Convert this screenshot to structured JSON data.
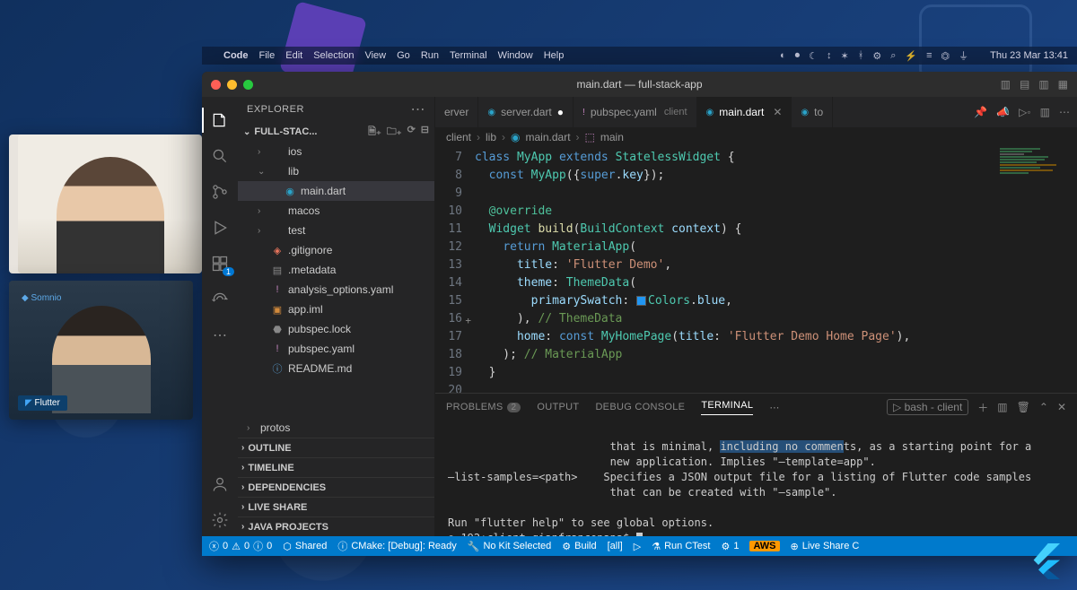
{
  "macbar": {
    "apple": "",
    "items": [
      "Code",
      "File",
      "Edit",
      "Selection",
      "View",
      "Go",
      "Run",
      "Terminal",
      "Window",
      "Help"
    ],
    "right_icons": [
      "◐",
      "⏺",
      "☾",
      "↕",
      "✶",
      "ᚼ",
      "⚙",
      "⌕",
      "⚡",
      "≡",
      "⏣",
      "⏚"
    ],
    "datetime": "Thu 23 Mar  13:41"
  },
  "window": {
    "title": "main.dart — full-stack-app"
  },
  "explorer": {
    "header": "EXPLORER",
    "project": "FULL-STAC...",
    "tree": [
      {
        "label": "ios",
        "chev": "›",
        "depth": 1,
        "icon": ""
      },
      {
        "label": "lib",
        "chev": "⌄",
        "depth": 1,
        "icon": ""
      },
      {
        "label": "main.dart",
        "chev": "",
        "depth": 2,
        "icon": "◉",
        "color": "#2aa3c9",
        "sel": true
      },
      {
        "label": "macos",
        "chev": "›",
        "depth": 1,
        "icon": ""
      },
      {
        "label": "test",
        "chev": "›",
        "depth": 1,
        "icon": ""
      },
      {
        "label": ".gitignore",
        "chev": "",
        "depth": 1,
        "icon": "◈",
        "color": "#e8745c"
      },
      {
        "label": ".metadata",
        "chev": "",
        "depth": 1,
        "icon": "▤",
        "color": "#888"
      },
      {
        "label": "analysis_options.yaml",
        "chev": "",
        "depth": 1,
        "icon": "!",
        "color": "#c586c0"
      },
      {
        "label": "app.iml",
        "chev": "",
        "depth": 1,
        "icon": "▣",
        "color": "#d28a3c"
      },
      {
        "label": "pubspec.lock",
        "chev": "",
        "depth": 1,
        "icon": "⬣",
        "color": "#888"
      },
      {
        "label": "pubspec.yaml",
        "chev": "",
        "depth": 1,
        "icon": "!",
        "color": "#c586c0"
      },
      {
        "label": "README.md",
        "chev": "",
        "depth": 1,
        "icon": "ⓘ",
        "color": "#5a9fd4"
      }
    ],
    "bottom_tree": [
      {
        "label": "protos",
        "chev": "›",
        "depth": 0
      }
    ],
    "sections": [
      "OUTLINE",
      "TIMELINE",
      "DEPENDENCIES",
      "LIVE SHARE",
      "JAVA PROJECTS"
    ]
  },
  "tabs": [
    {
      "label": "server",
      "icon": "",
      "sub": "erver",
      "active": false,
      "mod": false,
      "partial": true
    },
    {
      "label": "server.dart",
      "icon": "◉",
      "iconColor": "#2aa3c9",
      "active": false,
      "mod": true
    },
    {
      "label": "pubspec.yaml",
      "icon": "!",
      "iconColor": "#c586c0",
      "sub": "client",
      "active": false,
      "mod": false
    },
    {
      "label": "main.dart",
      "icon": "◉",
      "iconColor": "#2aa3c9",
      "active": true,
      "mod": false
    },
    {
      "label": "to",
      "icon": "◉",
      "iconColor": "#2aa3c9",
      "active": false,
      "partial": true
    }
  ],
  "breadcrumb": [
    "client",
    "lib",
    "main.dart",
    "main"
  ],
  "code": {
    "start": 7,
    "lines": [
      [
        [
          "kw",
          "class "
        ],
        [
          "ty",
          "MyApp "
        ],
        [
          "kw",
          "extends "
        ],
        [
          "ty",
          "StatelessWidget "
        ],
        [
          "pn",
          "{"
        ]
      ],
      [
        [
          "pn",
          "  "
        ],
        [
          "kw",
          "const "
        ],
        [
          "ty",
          "MyApp"
        ],
        [
          "pn",
          "({"
        ],
        [
          "kw",
          "super"
        ],
        [
          "pn",
          "."
        ],
        [
          "prm",
          "key"
        ],
        [
          "pn",
          "});"
        ]
      ],
      [
        [
          "pn",
          ""
        ]
      ],
      [
        [
          "pn",
          "  "
        ],
        [
          "an",
          "@override"
        ]
      ],
      [
        [
          "pn",
          "  "
        ],
        [
          "ty",
          "Widget "
        ],
        [
          "fn",
          "build"
        ],
        [
          "pn",
          "("
        ],
        [
          "ty",
          "BuildContext "
        ],
        [
          "prm",
          "context"
        ],
        [
          "pn",
          ") {"
        ]
      ],
      [
        [
          "pn",
          "    "
        ],
        [
          "kw",
          "return "
        ],
        [
          "ty",
          "MaterialApp"
        ],
        [
          "pn",
          "("
        ]
      ],
      [
        [
          "pn",
          "      "
        ],
        [
          "prm",
          "title"
        ],
        [
          "pn",
          ": "
        ],
        [
          "str",
          "'Flutter Demo'"
        ],
        [
          "pn",
          ","
        ]
      ],
      [
        [
          "pn",
          "      "
        ],
        [
          "prm",
          "theme"
        ],
        [
          "pn",
          ": "
        ],
        [
          "ty",
          "ThemeData"
        ],
        [
          "pn",
          "("
        ]
      ],
      [
        [
          "pn",
          "        "
        ],
        [
          "prm",
          "primarySwatch"
        ],
        [
          "pn",
          ": "
        ],
        [
          "swatch",
          ""
        ],
        [
          "ty",
          "Colors"
        ],
        [
          "pn",
          "."
        ],
        [
          "prm",
          "blue"
        ],
        [
          "pn",
          ","
        ]
      ],
      [
        [
          "pn",
          "      ), "
        ],
        [
          "cmt",
          "// ThemeData"
        ]
      ],
      [
        [
          "pn",
          "      "
        ],
        [
          "prm",
          "home"
        ],
        [
          "pn",
          ": "
        ],
        [
          "kw",
          "const "
        ],
        [
          "ty",
          "MyHomePage"
        ],
        [
          "pn",
          "("
        ],
        [
          "prm",
          "title"
        ],
        [
          "pn",
          ": "
        ],
        [
          "str",
          "'Flutter Demo Home Page'"
        ],
        [
          "pn",
          "),"
        ]
      ],
      [
        [
          "pn",
          "    ); "
        ],
        [
          "cmt",
          "// MaterialApp"
        ]
      ],
      [
        [
          "pn",
          "  }"
        ]
      ],
      [
        [
          "pn",
          ""
        ]
      ]
    ],
    "plus_at": 16
  },
  "panel": {
    "tabs": {
      "problems": "PROBLEMS",
      "problems_count": "2",
      "output": "OUTPUT",
      "debug": "DEBUG CONSOLE",
      "terminal": "TERMINAL"
    },
    "term_select": "bash - client",
    "terminal": {
      "l1a": "                         that is minimal, ",
      "l1h": "including no commen",
      "l1b": "ts, as a starting point for a",
      "l2": "                         new application. Implies \"—template=app\".",
      "l3": "—list-samples=<path>    Specifies a JSON output file for a listing of Flutter code samples",
      "l4": "                         that can be created with \"—sample\".",
      "l5": "",
      "l6": "Run \"flutter help\" to see global options.",
      "prompt": "192:client gianfrancopapa$ "
    }
  },
  "status": {
    "errors": "0",
    "warnings": "0",
    "info": "0",
    "shared": "Shared",
    "cmake": "CMake: [Debug]: Ready",
    "kit": "No Kit Selected",
    "build": "Build",
    "target": "[all]",
    "debug_icon": "▷",
    "ctest": "Run CTest",
    "tests": "1",
    "aws": "AWS",
    "liveshare": "Live Share C"
  },
  "webcams": {
    "flutter": "Flutter"
  }
}
